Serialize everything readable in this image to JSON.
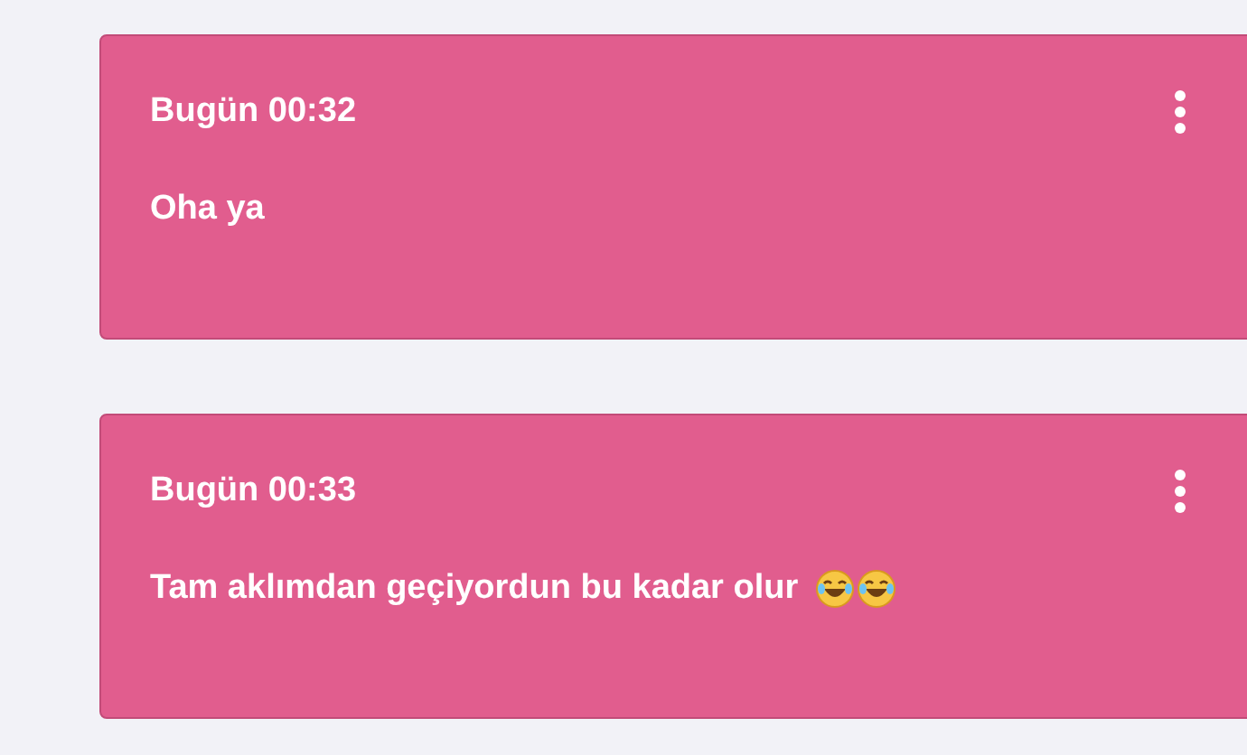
{
  "messages": [
    {
      "time": "Bugün 00:32",
      "text": "Oha ya"
    },
    {
      "time": "Bugün 00:33",
      "text": "Tam aklımdan geçiyordun bu kadar olur",
      "emojis": [
        {
          "kind": "tears-of-joy"
        },
        {
          "kind": "tears-of-joy"
        }
      ]
    }
  ]
}
